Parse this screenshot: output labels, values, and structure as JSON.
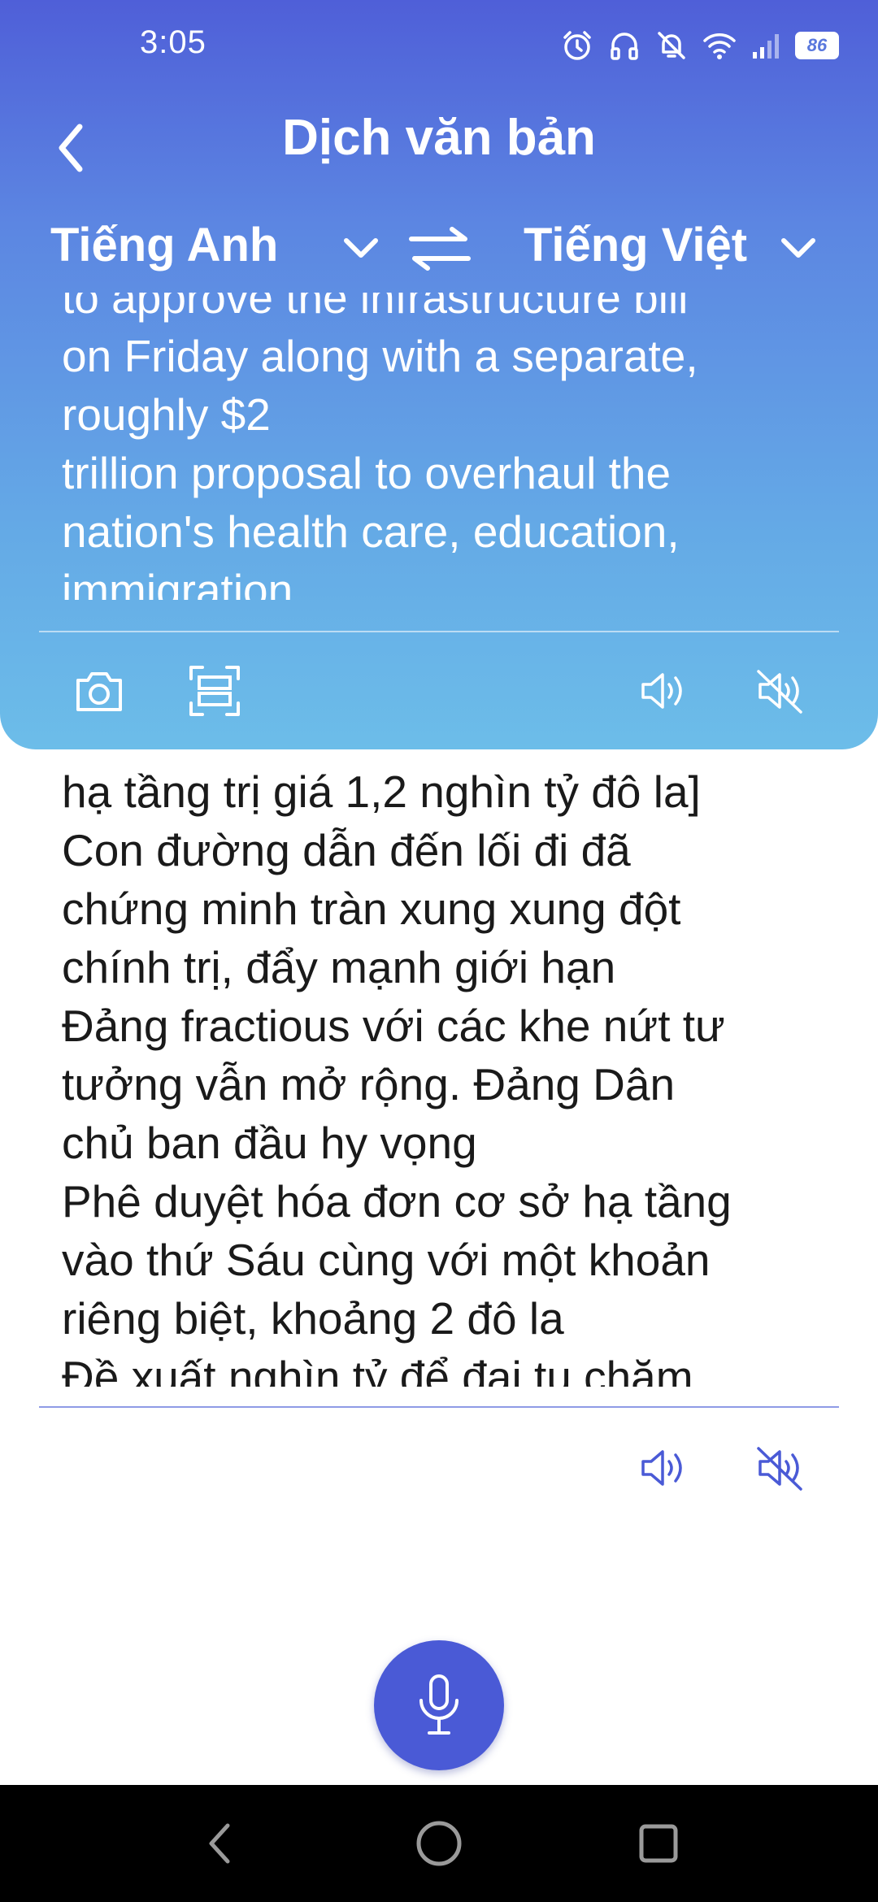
{
  "status_bar": {
    "time": "3:05",
    "battery_level": "86",
    "icons": [
      "alarm-icon",
      "headphones-icon",
      "bell-muted-icon",
      "wifi-icon",
      "signal-icon",
      "battery-icon"
    ]
  },
  "header": {
    "title": "Dịch văn bản",
    "back_icon": "chevron-left-icon"
  },
  "languages": {
    "source": "Tiếng Anh",
    "target": "Tiếng Việt",
    "swap_icon": "swap-arrows-icon"
  },
  "source_panel": {
    "text": "to approve the infrastructure bill\non Friday along with a separate,\nroughly $2\ntrillion proposal to overhaul the\nnation's health care, education,\nimmigration",
    "actions": {
      "camera_icon": "camera-icon",
      "scan_icon": "scan-icon",
      "speak_icon": "speaker-icon",
      "mute_icon": "speaker-muted-icon"
    }
  },
  "result_panel": {
    "text": "hạ tầng trị giá 1,2 nghìn tỷ đô la]\nCon đường dẫn đến lối đi đã\nchứng minh tràn xung xung đột\nchính trị, đẩy mạnh giới hạn\nĐảng fractious với các khe nứt tư\ntưởng vẫn mở rộng. Đảng Dân\nchủ ban đầu hy vọng\nPhê duyệt hóa đơn cơ sở hạ tầng\nvào thứ Sáu cùng với một khoản\nriêng biệt, khoảng 2 đô la\nĐề xuất nghìn tỷ để đại tu chăm",
    "actions": {
      "speak_icon": "speaker-icon",
      "mute_icon": "speaker-muted-icon"
    }
  },
  "mic": {
    "icon": "microphone-icon"
  },
  "nav_bar": {
    "items": [
      "back-nav-icon",
      "home-nav-icon",
      "recents-nav-icon"
    ]
  },
  "colors": {
    "gradient_top": "#4f5fd8",
    "gradient_bottom": "#6cbde9",
    "accent": "#4a5ad6",
    "result_icon": "#4a5ad6"
  }
}
